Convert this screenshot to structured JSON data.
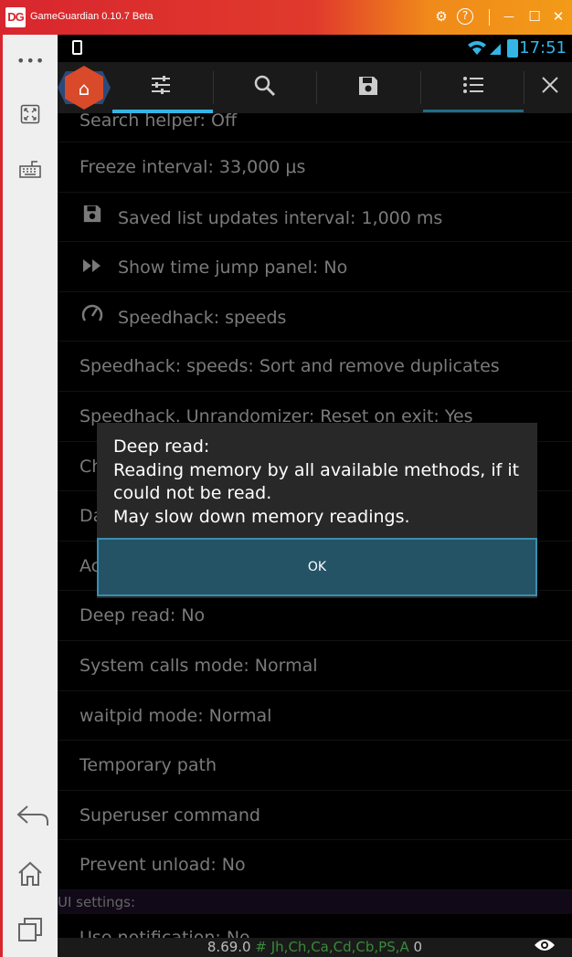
{
  "window": {
    "logo_text": "DG",
    "title": "GameGuardian 0.10.7 Beta",
    "buttons": {
      "settings": "⚙",
      "help": "?",
      "minimize": "—",
      "maximize": "☐",
      "close": "✕"
    }
  },
  "status_bar": {
    "time": "17:51"
  },
  "toolbar": {
    "icons": [
      "home-icon",
      "sliders-icon",
      "search-icon",
      "save-icon",
      "list-icon",
      "close-icon"
    ]
  },
  "settings": {
    "items": [
      {
        "label": "Search helper: Off",
        "icon": ""
      },
      {
        "label": "Freeze interval: 33,000 μs",
        "icon": ""
      },
      {
        "label": "Saved list updates interval: 1,000 ms",
        "icon": "save-icon"
      },
      {
        "label": "Show time jump panel: No",
        "icon": "fast-forward-icon"
      },
      {
        "label": "Speedhack: speeds",
        "icon": "speedometer-icon"
      },
      {
        "label": "Speedhack: speeds: Sort and remove duplicates",
        "icon": ""
      },
      {
        "label": "Speedhack. Unrandomizer: Reset on exit: Yes",
        "icon": ""
      },
      {
        "label": "Ch",
        "icon": ""
      },
      {
        "label": "Da",
        "icon": ""
      },
      {
        "label": "Ac",
        "icon": ""
      },
      {
        "label": "Deep read: No",
        "icon": ""
      },
      {
        "label": "System calls mode: Normal",
        "icon": ""
      },
      {
        "label": "waitpid mode: Normal",
        "icon": ""
      },
      {
        "label": "Temporary path",
        "icon": ""
      },
      {
        "label": "Superuser command",
        "icon": ""
      },
      {
        "label": "Prevent unload: No",
        "icon": ""
      }
    ],
    "section_ui": "UI settings:",
    "after_section": "Use notification: No"
  },
  "dialog": {
    "title": "Deep read:",
    "line1": "Reading memory by all available methods, if it could not be read.",
    "line2": "May slow down memory readings.",
    "ok_label": "OK"
  },
  "bottom_bar": {
    "version": "8.69.0",
    "hash": "#",
    "regions": "Jh,Ch,Ca,Cd,Cb,PS,A",
    "count": "0"
  }
}
